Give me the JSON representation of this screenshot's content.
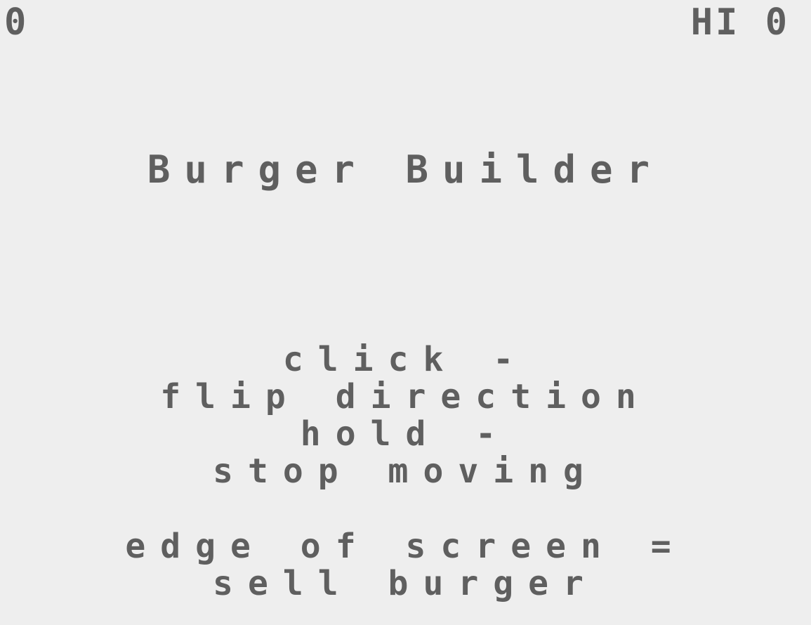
{
  "hud": {
    "score": "0",
    "hi_label": "HI",
    "hi_value": "0"
  },
  "title": "Burger Builder",
  "instructions": [
    "click -",
    "flip direction",
    "hold -",
    "stop moving",
    "edge of screen =",
    "sell burger"
  ],
  "colors": {
    "background": "#eeeeee",
    "text": "#5f5f5f"
  }
}
